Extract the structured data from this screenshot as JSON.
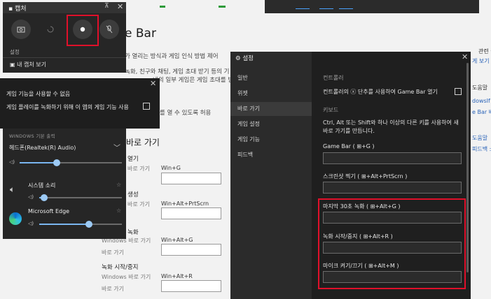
{
  "background": {
    "title": "e Bar",
    "desc1": "가 열리는 방식과 게임 인식 방법 제어",
    "desc2": "녹화, 친구와 채팅, 게임 초대 받기 등의 기",
    "desc3": "내의 일부 게임은 게임 초대를 받",
    "desc4": "를 열 수 있도록 허용",
    "section": "바로 가기",
    "right": {
      "r1": "관련 설정",
      "r2": "게 보기",
      "r3": "도움말",
      "r4": "dowsIf",
      "r5": "e Bar 베",
      "r6": "도움말",
      "r7": "피드백 :"
    },
    "shortcuts": [
      {
        "label": "열기",
        "sub": "바로 가기",
        "key": "Win+G"
      },
      {
        "label": "생성",
        "sub": "바로 가기",
        "key": "Win+Alt+PrtScrn"
      },
      {
        "label": "녹화",
        "sub": "Windows 바로 가기",
        "key": "Win+Alt+G"
      },
      {
        "label": "녹화 시작/중지",
        "sub": "Windows 바로 가기",
        "key": "Win+Alt+R"
      }
    ],
    "sub_extra1": "바로 가기",
    "sub_extra2": "바로 가기"
  },
  "capture": {
    "title": "캡처",
    "pin": "⊼",
    "close": "✕",
    "sub": "설정",
    "show_captures": "내 캡처 보기"
  },
  "notice": {
    "close": "✕",
    "line1": "게임 기능을 사용할 수 없음",
    "line2": "게임 플레이를 녹화하기 위해 이 앱의 게임 기능 사용"
  },
  "audio": {
    "header": "WINDOWS 기본 출력",
    "device": "헤드폰(Realtek(R) Audio)",
    "system_sound": "시스템 소리",
    "edge": "Microsoft Edge",
    "master_level": 0.36,
    "system_level": 0.06,
    "edge_level": 0.6
  },
  "settings": {
    "title": "설정",
    "close": "✕",
    "nav": [
      "일반",
      "위젯",
      "바로 가기",
      "게임 설정",
      "게임 기능",
      "피드백"
    ],
    "controller_hdr": "컨트롤러",
    "controller_txt": "컨트롤러의 ⓧ 단추를 사용하여 Game Bar 열기",
    "keyboard_hdr": "키보드",
    "kb_desc1": "Ctrl, Alt 또는 Shift와 하나 이상의 다른 키를 사용하여 새",
    "kb_desc2": "바로 가기를 만듭니다.",
    "fields": [
      {
        "label": "Game Bar ( ⊞+G )"
      },
      {
        "label": "스크린샷 찍기 ( ⊞+Alt+PrtScrn )"
      },
      {
        "label": "마지막 30초 녹화 ( ⊞+Alt+G )"
      },
      {
        "label": "녹화 시작/중지 ( ⊞+Alt+R )"
      },
      {
        "label": "마이크 켜기/끄기 ( ⊞+Alt+M )"
      }
    ]
  },
  "colors": {
    "highlight": "#e0102a",
    "accent": "#7ab6f0"
  }
}
